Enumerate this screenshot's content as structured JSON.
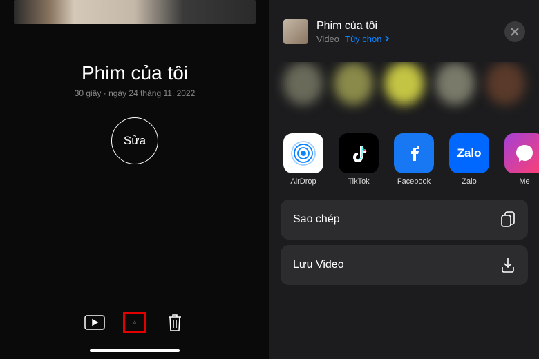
{
  "left": {
    "project_title": "Phim của tôi",
    "project_meta": "30 giây · ngày 24 tháng 11, 2022",
    "edit_label": "Sửa"
  },
  "share": {
    "title": "Phim của tôi",
    "type_label": "Video",
    "options_label": "Tùy chọn",
    "apps": [
      {
        "label": "AirDrop"
      },
      {
        "label": "TikTok"
      },
      {
        "label": "Facebook"
      },
      {
        "label": "Zalo"
      },
      {
        "label": "Me"
      }
    ],
    "actions": {
      "copy_label": "Sao chép",
      "save_label": "Lưu Video"
    }
  }
}
